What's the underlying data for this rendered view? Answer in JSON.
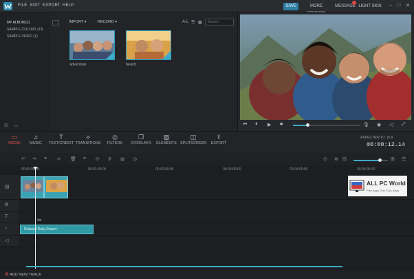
{
  "menu": {
    "items": [
      "FILE",
      "EDIT",
      "EXPORT",
      "HELP"
    ]
  },
  "top_actions": {
    "save": "SAVE",
    "more_effects": "MORE EFFECTS",
    "message": "MESSAGE",
    "theme": "LIGHT SKIN"
  },
  "window_controls": {
    "minimize": "–",
    "maximize": "□",
    "close": "✕"
  },
  "library": {
    "sidebar": [
      "MY ALBUM (2)",
      "SAMPLE COLORS (13)",
      "SAMPLE VIDEO (1)"
    ],
    "import_label": "IMPORT",
    "record_label": "RECORD",
    "filter_label": "A-L",
    "search_placeholder": "Search",
    "items": [
      {
        "label": "adventure"
      },
      {
        "label": "beach"
      }
    ]
  },
  "preview": {
    "progress": 0.21
  },
  "toolbar": {
    "tools": [
      {
        "label": "MEDIA",
        "icon": "folder-icon"
      },
      {
        "label": "MUSIC",
        "icon": "music-note-icon"
      },
      {
        "label": "TEXT/CREDIT",
        "icon": "text-icon"
      },
      {
        "label": "TRANSITIONS",
        "icon": "transitions-icon"
      },
      {
        "label": "FILTERS",
        "icon": "filters-icon"
      },
      {
        "label": "OVERLAYS",
        "icon": "overlays-icon"
      },
      {
        "label": "ELEMENTS",
        "icon": "elements-icon"
      },
      {
        "label": "SPLITSCREEN",
        "icon": "splitscreen-icon"
      },
      {
        "label": "EXPORT",
        "icon": "export-icon"
      }
    ],
    "aspect_ratio": "ASPECTRATIO: 16:9",
    "timecode": "00:00:12.14"
  },
  "timeline": {
    "ruler_ticks": [
      "00:00:00:00",
      "00:01:00:00",
      "00:02:00:00",
      "00:03:00:00",
      "00:04:00:00",
      "00:05:00:00"
    ],
    "zoom_level": 0.76,
    "audio_clip_label": "Relaxed Daily Report",
    "add_track_label": "ADD NEW TRACK"
  },
  "watermark": {
    "title": "ALL PC World",
    "subtitle": "Free Apps One Click Away"
  },
  "colors": {
    "accent": "#3fa9c9",
    "active_tool": "#e0534b",
    "save": "#2f7ea4",
    "clip": "#3aa4b4"
  }
}
